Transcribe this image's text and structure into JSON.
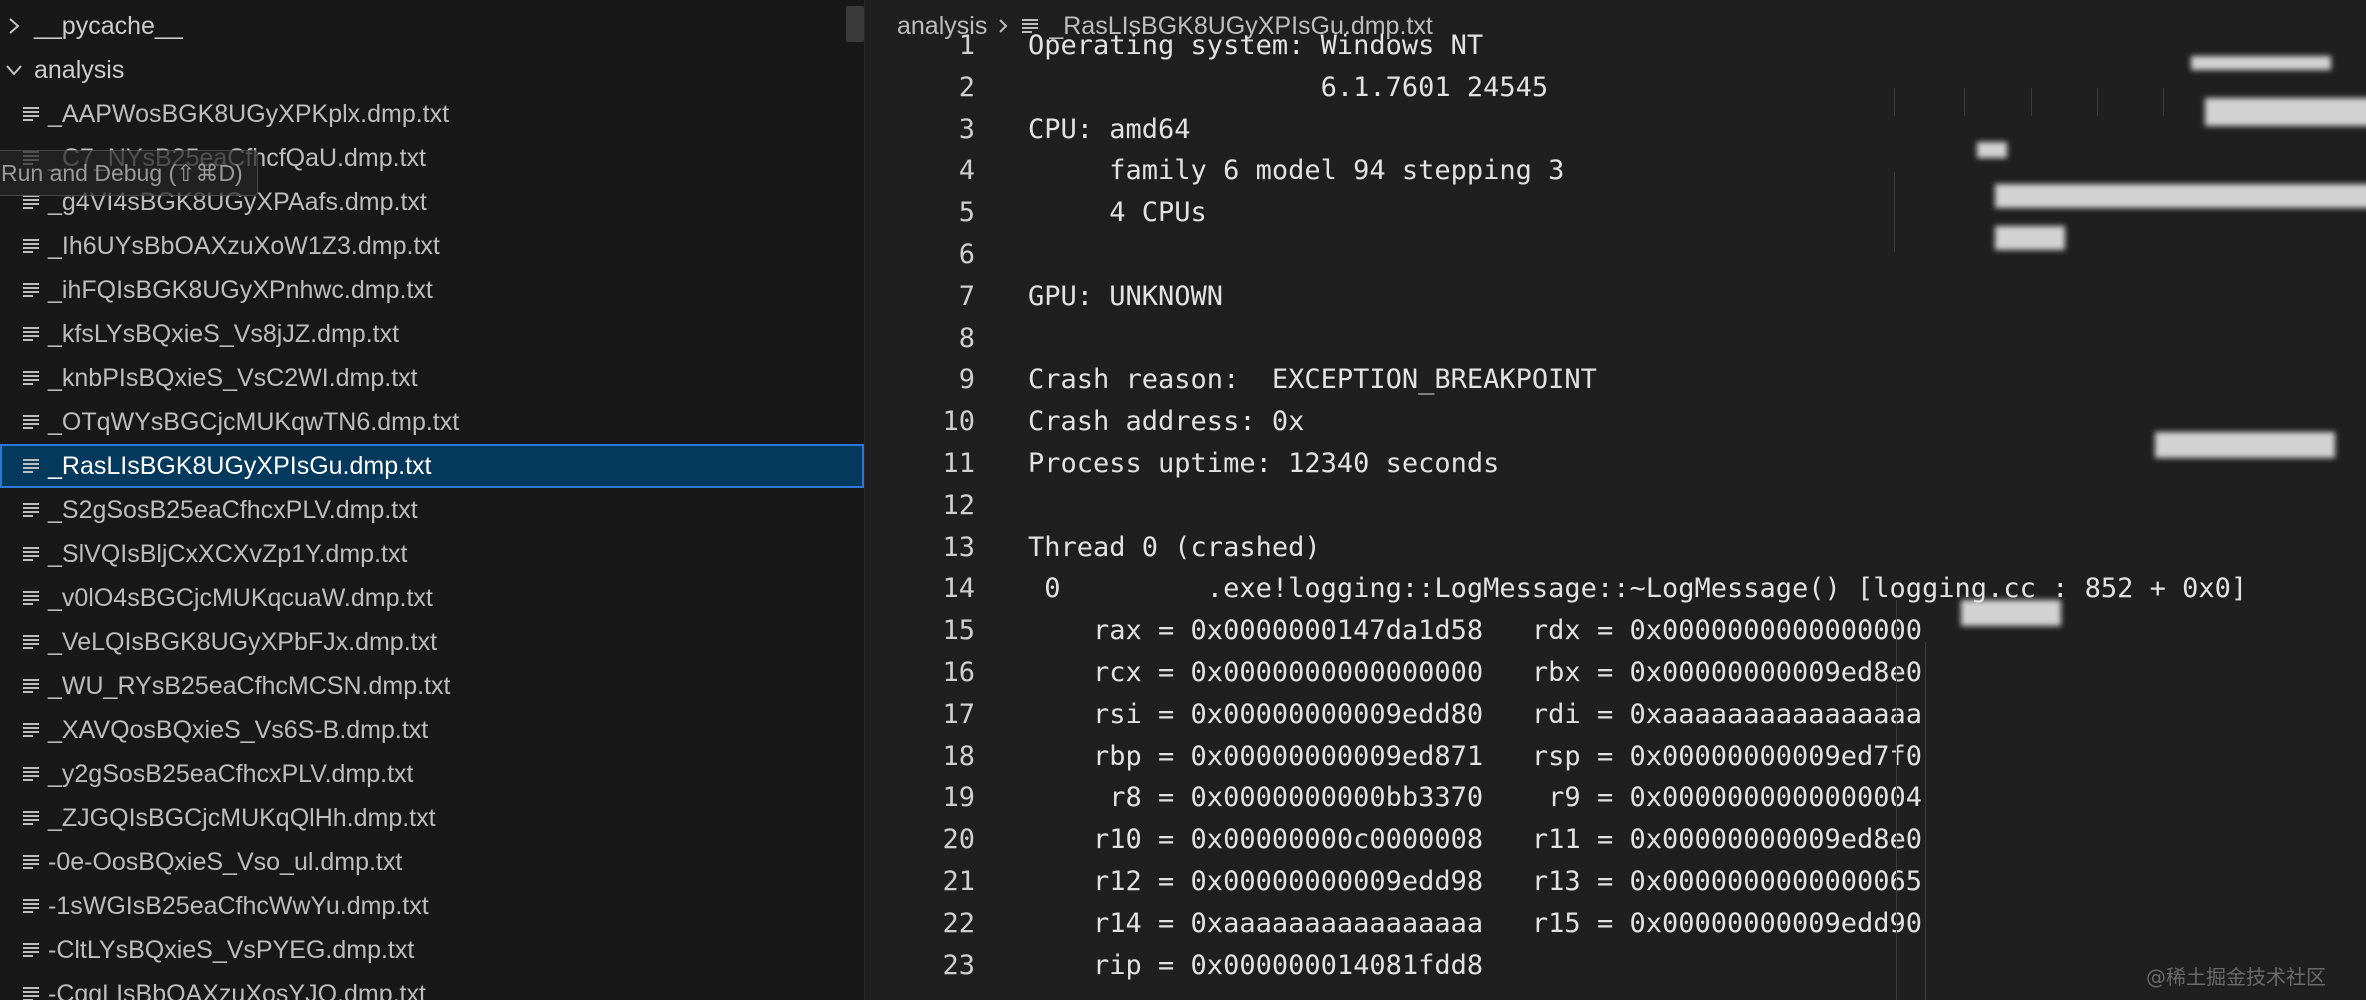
{
  "explorer": {
    "folders": [
      {
        "label": "__pycache__",
        "expanded": false
      },
      {
        "label": "analysis",
        "expanded": true
      }
    ],
    "files": [
      "_AAPWosBGK8UGyXPKplx.dmp.txt",
      "_C7_NYsB25eaCfhcfQaU.dmp.txt",
      "_g4VI4sBGK8UGyXPAafs.dmp.txt",
      "_Ih6UYsBbOAXzuXoW1Z3.dmp.txt",
      "_ihFQIsBGK8UGyXPnhwc.dmp.txt",
      "_kfsLYsBQxieS_Vs8jJZ.dmp.txt",
      "_knbPIsBQxieS_VsC2WI.dmp.txt",
      "_OTqWYsBGCjcMUKqwTN6.dmp.txt",
      "_RasLIsBGK8UGyXPIsGu.dmp.txt",
      "_S2gSosB25eaCfhcxPLV.dmp.txt",
      "_SlVQIsBljCxXCXvZp1Y.dmp.txt",
      "_v0lO4sBGCjcMUKqcuaW.dmp.txt",
      "_VeLQIsBGK8UGyXPbFJx.dmp.txt",
      "_WU_RYsB25eaCfhcMCSN.dmp.txt",
      "_XAVQosBQxieS_Vs6S-B.dmp.txt",
      "_y2gSosB25eaCfhcxPLV.dmp.txt",
      "_ZJGQIsBGCjcMUKqQlHh.dmp.txt",
      "-0e-OosBQxieS_Vso_ul.dmp.txt",
      "-1sWGIsB25eaCfhcWwYu.dmp.txt",
      "-CltLYsBQxieS_VsPYEG.dmp.txt",
      "-CqgLIsBbOAXzuXosYJQ.dmp.txt"
    ],
    "selected_file": "_RasLIsBGK8UGyXPIsGu.dmp.txt",
    "tooltip": "Run and Debug (⇧⌘D)"
  },
  "editor": {
    "breadcrumb": {
      "folder": "analysis",
      "file": "_RasLIsBGK8UGyXPIsGu.dmp.txt"
    },
    "lines": [
      {
        "n": "1",
        "text": "Operating system: Windows NT"
      },
      {
        "n": "2",
        "text": "                  6.1.7601 24545"
      },
      {
        "n": "3",
        "text": "CPU: amd64"
      },
      {
        "n": "4",
        "text": "     family 6 model 94 stepping 3"
      },
      {
        "n": "5",
        "text": "     4 CPUs"
      },
      {
        "n": "6",
        "text": ""
      },
      {
        "n": "7",
        "text": "GPU: UNKNOWN"
      },
      {
        "n": "8",
        "text": ""
      },
      {
        "n": "9",
        "text": "Crash reason:  EXCEPTION_BREAKPOINT"
      },
      {
        "n": "10",
        "text": "Crash address: 0x"
      },
      {
        "n": "11",
        "text": "Process uptime: 12340 seconds"
      },
      {
        "n": "12",
        "text": ""
      },
      {
        "n": "13",
        "text": "Thread 0 (crashed)"
      },
      {
        "n": "14",
        "text": " 0         .exe!logging::LogMessage::~LogMessage() [logging.cc : 852 + 0x0]"
      },
      {
        "n": "15",
        "text": "    rax = 0x0000000147da1d58   rdx = 0x0000000000000000"
      },
      {
        "n": "16",
        "text": "    rcx = 0x0000000000000000   rbx = 0x00000000009ed8e0"
      },
      {
        "n": "17",
        "text": "    rsi = 0x00000000009edd80   rdi = 0xaaaaaaaaaaaaaaaa"
      },
      {
        "n": "18",
        "text": "    rbp = 0x00000000009ed871   rsp = 0x00000000009ed7f0"
      },
      {
        "n": "19",
        "text": "     r8 = 0x0000000000bb3370    r9 = 0x0000000000000004"
      },
      {
        "n": "20",
        "text": "    r10 = 0x00000000c0000008   r11 = 0x00000000009ed8e0"
      },
      {
        "n": "21",
        "text": "    r12 = 0x00000000009edd98   r13 = 0x0000000000000065"
      },
      {
        "n": "22",
        "text": "    r14 = 0xaaaaaaaaaaaaaaaa   r15 = 0x00000000009edd90"
      },
      {
        "n": "23",
        "text": "    rip = 0x000000014081fdd8"
      }
    ]
  },
  "watermark": "@稀土掘金技术社区",
  "colors": {
    "sidebar_bg": "#181818",
    "editor_bg": "#1f1f1f",
    "selection_bg": "#04395e",
    "selection_border": "#2b79d7",
    "text": "#e2e2e2"
  }
}
